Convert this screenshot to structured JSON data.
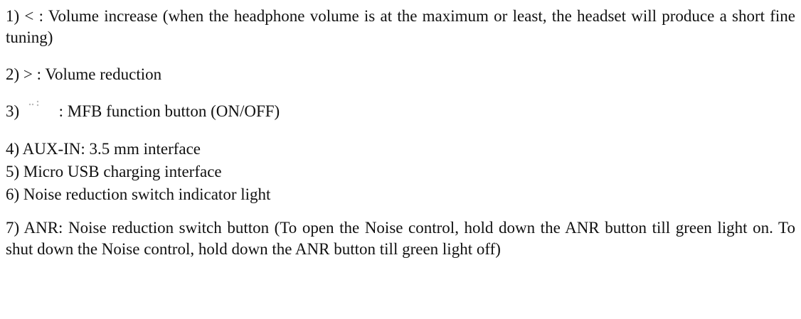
{
  "items": [
    {
      "number": "1)",
      "text": "< : Volume increase (when the headphone volume is at the maximum or least, the headset will produce a short fine tuning)"
    },
    {
      "number": "2)",
      "text": "> : Volume reduction"
    },
    {
      "number": "3)",
      "icon": "mfb-button-icon",
      "text": ": MFB function button (ON/OFF)"
    },
    {
      "number": "4)",
      "text": "AUX-IN: 3.5 mm interface"
    },
    {
      "number": "5)",
      "text": "Micro USB charging interface"
    },
    {
      "number": "6)",
      "text": "Noise reduction switch indicator light"
    },
    {
      "number": "7)",
      "text": "ANR: Noise reduction switch button (To open the Noise control, hold down the ANR button till green light on. To shut down the Noise control, hold down the ANR button till green light off)"
    }
  ]
}
